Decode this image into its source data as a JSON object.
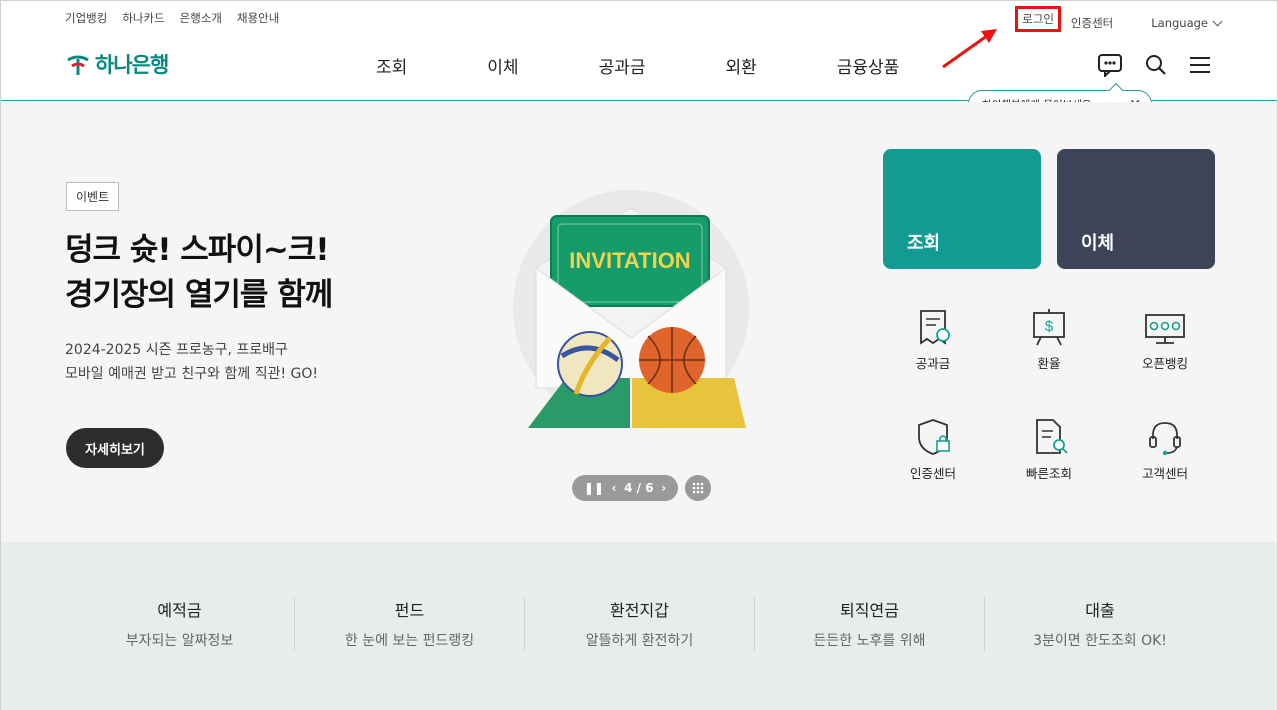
{
  "util": {
    "left_links": [
      "기업뱅킹",
      "하나카드",
      "은행소개",
      "채용안내"
    ],
    "login": "로그인",
    "cert_center": "인증센터",
    "language": "Language"
  },
  "header": {
    "logo": "하나은행",
    "nav": [
      "조회",
      "이체",
      "공과금",
      "외환",
      "금융상품"
    ]
  },
  "chat_tip": {
    "text": "하이챗봇에게 물어보세요~"
  },
  "hero": {
    "badge": "이벤트",
    "title_line1": "덩크 슛! 스파이~크!",
    "title_line2": "경기장의 열기를 함께",
    "sub_line1": "2024-2025 시즌 프로농구, 프로배구",
    "sub_line2": "모바일 예매권 받고 친구와 함께 직관! GO!",
    "button": "자세히보기",
    "illustration_text": "INVITATION",
    "pager": "4 / 6"
  },
  "tiles": {
    "inquiry": "조회",
    "transfer": "이체"
  },
  "quick": [
    "공과금",
    "환율",
    "오픈뱅킹",
    "인증센터",
    "빠른조회",
    "고객센터"
  ],
  "band": [
    {
      "title": "예적금",
      "sub": "부자되는 알짜정보"
    },
    {
      "title": "펀드",
      "sub": "한 눈에 보는 펀드랭킹"
    },
    {
      "title": "환전지갑",
      "sub": "알뜰하게 환전하기"
    },
    {
      "title": "퇴직연금",
      "sub": "든든한 노후를 위해"
    },
    {
      "title": "대출",
      "sub": "3분이면 한도조회 OK!"
    }
  ],
  "colors": {
    "brand": "#0a8a7e",
    "tile_teal": "#129b92",
    "tile_navy": "#3d4458",
    "highlight": "#ee1111"
  }
}
